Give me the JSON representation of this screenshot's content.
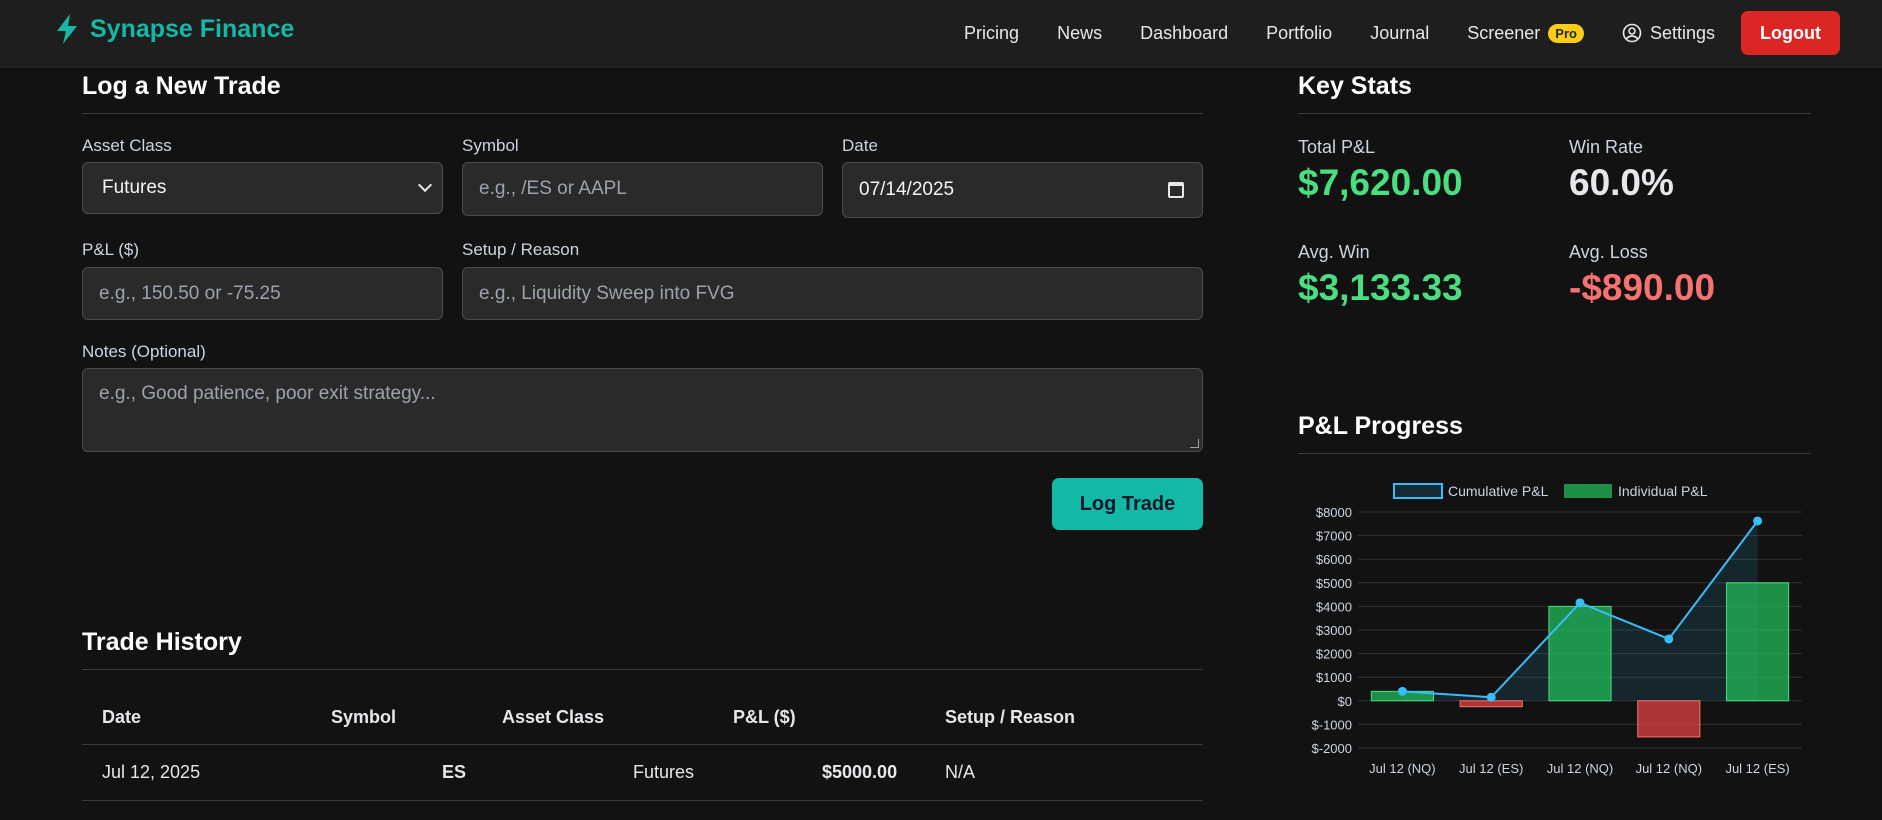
{
  "brand": {
    "name": "Synapse Finance",
    "accent": "#14b8a6"
  },
  "nav": {
    "links": [
      "Pricing",
      "News",
      "Dashboard",
      "Portfolio",
      "Journal",
      "Screener"
    ],
    "pro_badge": "Pro",
    "settings": "Settings",
    "logout": "Logout"
  },
  "form": {
    "title": "Log a New Trade",
    "asset_class": {
      "label": "Asset Class",
      "value": "Futures"
    },
    "symbol": {
      "label": "Symbol",
      "placeholder": "e.g., /ES or AAPL"
    },
    "date": {
      "label": "Date",
      "value": "07/14/2025"
    },
    "pnl": {
      "label": "P&L ($)",
      "placeholder": "e.g., 150.50 or -75.25"
    },
    "setup": {
      "label": "Setup / Reason",
      "placeholder": "e.g., Liquidity Sweep into FVG"
    },
    "notes": {
      "label": "Notes (Optional)",
      "placeholder": "e.g., Good patience, poor exit strategy..."
    },
    "submit": "Log Trade"
  },
  "history": {
    "title": "Trade History",
    "columns": [
      "Date",
      "Symbol",
      "Asset Class",
      "P&L ($)",
      "Setup / Reason"
    ],
    "rows": [
      {
        "date": "Jul 12, 2025",
        "symbol": "ES",
        "asset_class": "Futures",
        "pnl": "$5000.00",
        "setup": "N/A"
      }
    ]
  },
  "stats": {
    "title": "Key Stats",
    "total_pnl": {
      "label": "Total P&L",
      "value": "$7,620.00"
    },
    "win_rate": {
      "label": "Win Rate",
      "value": "60.0%"
    },
    "avg_win": {
      "label": "Avg. Win",
      "value": "$3,133.33"
    },
    "avg_loss": {
      "label": "Avg. Loss",
      "value": "-$890.00"
    },
    "colors": {
      "positive": "#4ade80",
      "negative": "#f87171",
      "neutral": "#e5e7eb"
    }
  },
  "progress": {
    "title": "P&L Progress"
  },
  "chart_data": {
    "type": "bar",
    "categories": [
      "Jul 12 (NQ)",
      "Jul 12 (ES)",
      "Jul 12 (NQ)",
      "Jul 12 (NQ)",
      "Jul 12 (ES)"
    ],
    "series": [
      {
        "name": "Cumulative P&L",
        "type": "line",
        "color": "#38bdf8",
        "values": [
          400,
          150,
          4150,
          2620,
          7620
        ]
      },
      {
        "name": "Individual P&L",
        "type": "bar",
        "color": "#22c55e",
        "negative_color": "#ef4444",
        "values": [
          400,
          -250,
          4000,
          -1530,
          5000
        ]
      }
    ],
    "yticks": [
      "$8000",
      "$7000",
      "$6000",
      "$5000",
      "$4000",
      "$3000",
      "$2000",
      "$1000",
      "$0",
      "$-1000",
      "$-2000"
    ],
    "ylim": [
      -2000,
      8000
    ],
    "grid": true,
    "legend": "top-center"
  }
}
